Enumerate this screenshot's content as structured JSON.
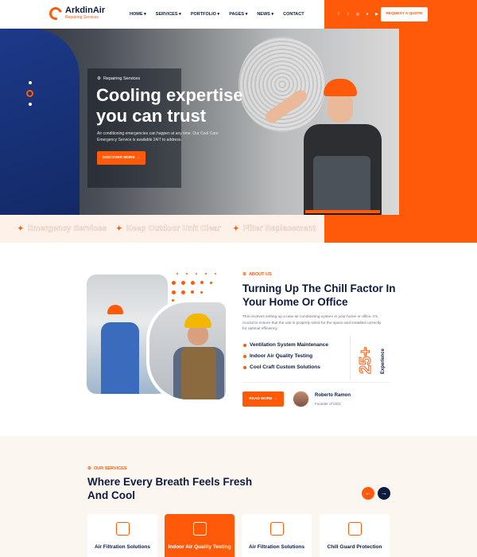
{
  "header": {
    "brand_name": "ArkdinAir",
    "brand_sub": "Repairing Services",
    "nav": [
      "HOME ▾",
      "SERVICES ▾",
      "PORTFOLIO ▾",
      "PAGES ▾",
      "NEWS ▾",
      "CONTACT"
    ],
    "social_icons": [
      "facebook-icon",
      "twitter-icon",
      "instagram-icon",
      "flickr-icon",
      "youtube-icon"
    ],
    "quote_label": "REQUEST A QUOTE"
  },
  "hero": {
    "tag": "Repairing Services",
    "title": "Cooling expertise you can trust",
    "description": "Air conditioning emergencies can happen at any time. Our Cool Care Emergency Service is available 24/7 to address.",
    "button_label": "DISCOVER MORE"
  },
  "ticker": [
    "Emergency Services",
    "Keep Outdoor Unit Clear",
    "Filter Replacement"
  ],
  "about": {
    "tag": "ABOUT US",
    "title": "Turning Up The Chill Factor In Your Home Or Office",
    "description": "This involves setting up a new air conditioning system in your home or office. It's crucial to ensure that the unit is properly sized for the space and installed correctly for optimal efficiency.",
    "list": [
      "Ventilation System Maintenance",
      "Indoor Air Quality Testing",
      "Cool Craft Custom Solutions"
    ],
    "experience_number": "25+",
    "experience_label": "Experience",
    "button_label": "READ MORE",
    "author_name": "Roberto Ramon",
    "author_role": "Founder of CEO"
  },
  "services": {
    "tag": "OUR SERVICES",
    "title": "Where Every Breath Feels Fresh And Cool",
    "cards": [
      {
        "title": "Air Filtration Solutions",
        "icon": "air-filter-icon"
      },
      {
        "title": "Indoor Air Quality Testing",
        "icon": "air-quality-icon"
      },
      {
        "title": "Air Filtration Solutions",
        "icon": "air-conditioner-icon"
      },
      {
        "title": "Chill Guard Protection",
        "icon": "house-shield-icon"
      }
    ]
  },
  "colors": {
    "accent": "#ff5a0a",
    "navy": "#0d1b3e"
  }
}
